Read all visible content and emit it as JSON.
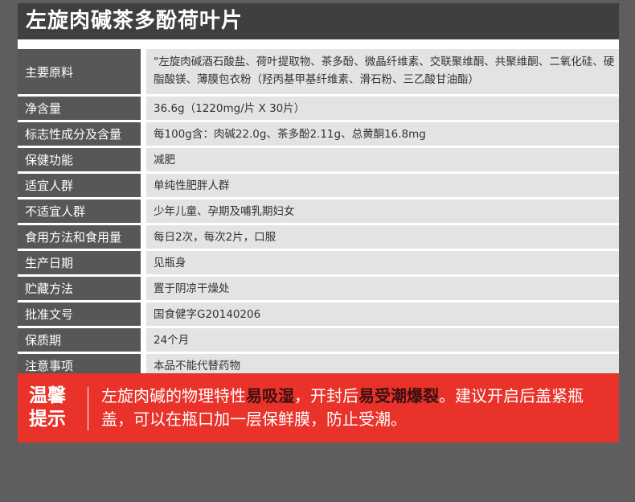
{
  "title": "左旋肉碱茶多酚荷叶片",
  "rows": [
    {
      "label": "主要原料",
      "value": "\"左旋肉碱酒石酸盐、荷叶提取物、茶多酚、微晶纤维素、交联聚维酮、共聚维酮、二氧化硅、硬脂酸镁、薄膜包衣粉（羟丙基甲基纤维素、滑石粉、三乙酸甘油酯）"
    },
    {
      "label": "净含量",
      "value": "36.6g（1220mg/片 X 30片）"
    },
    {
      "label": "标志性成分及含量",
      "value": "每100g含：肉碱22.0g、茶多酚2.11g、总黄酮16.8mg"
    },
    {
      "label": "保健功能",
      "value": "减肥"
    },
    {
      "label": "适宜人群",
      "value": "单纯性肥胖人群"
    },
    {
      "label": "不适宜人群",
      "value": "少年儿童、孕期及哺乳期妇女"
    },
    {
      "label": "食用方法和食用量",
      "value": "每日2次，每次2片，口服"
    },
    {
      "label": "生产日期",
      "value": "见瓶身"
    },
    {
      "label": "贮藏方法",
      "value": "置于阴凉干燥处"
    },
    {
      "label": "批准文号",
      "value": "国食健字G20140206"
    },
    {
      "label": "保质期",
      "value": "24个月"
    },
    {
      "label": "注意事项",
      "value": "本品不能代替药物"
    }
  ],
  "tip": {
    "title_line1": "温馨",
    "title_line2": "提示",
    "part1": "左旋肉碱的物理特性",
    "highlight1": "易吸湿",
    "part2": "，开封后",
    "highlight2": "易受潮爆裂",
    "part3": "。建议开启后盖紧瓶盖，可以在瓶口加一层保鲜膜，防止受潮。"
  },
  "colors": {
    "background": "#5e5e5e",
    "title_bar": "#3f3f3f",
    "label_cell": "#575757",
    "value_cell": "#e3e3e3",
    "tip_bg": "#e8322a",
    "highlight_text": "#3a1010"
  }
}
